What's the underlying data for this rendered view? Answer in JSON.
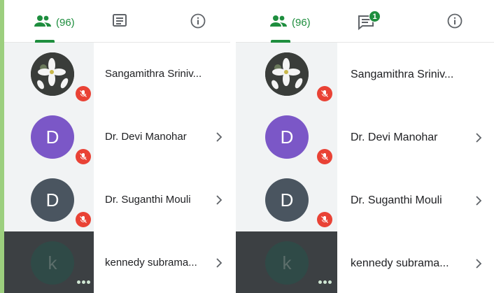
{
  "participant_count": "(96)",
  "chat_badge": "1",
  "colors": {
    "accent": "#1e8e3e",
    "mic_off": "#e94235",
    "avatar_purple": "#7b57c7",
    "avatar_slate": "#4a5560",
    "avatar_dim": "#2f4a47"
  },
  "tabs": [
    {
      "name": "people",
      "icon": "people-icon"
    },
    {
      "name": "chat",
      "icon": "chat-icon"
    },
    {
      "name": "info",
      "icon": "info-icon"
    }
  ],
  "left_panel": {
    "participants": [
      {
        "name": "Sangamithra Sriniv...",
        "avatar": "flower-photo",
        "muted": true
      },
      {
        "name": "Dr. Devi Manohar",
        "initial": "D",
        "muted": true
      },
      {
        "name": "Dr. Suganthi Mouli",
        "initial": "D",
        "muted": true
      },
      {
        "name": "kennedy subrama...",
        "initial": "k",
        "speaking": true
      }
    ]
  },
  "right_panel": {
    "participants": [
      {
        "name": "Sangamithra Sriniv...",
        "avatar": "flower-photo",
        "muted": true
      },
      {
        "name": "Dr. Devi Manohar",
        "initial": "D",
        "muted": true
      },
      {
        "name": "Dr. Suganthi Mouli",
        "initial": "D",
        "muted": true
      },
      {
        "name": "kennedy subrama...",
        "initial": "k",
        "speaking": true
      }
    ]
  }
}
